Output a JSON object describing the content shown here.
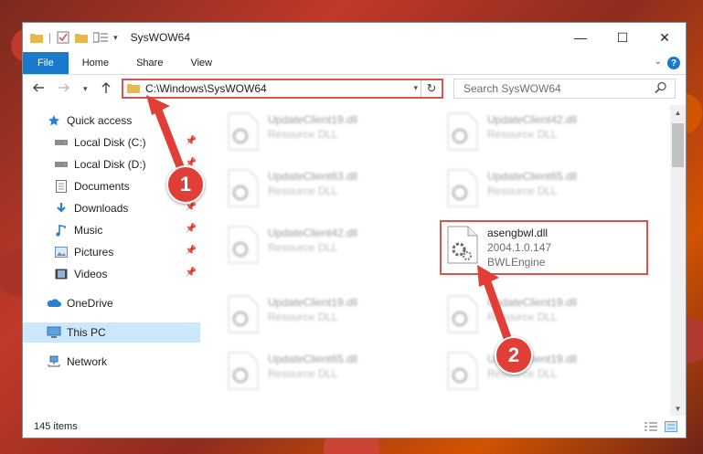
{
  "window": {
    "title": "SysWOW64",
    "controls": {
      "minimize": "—",
      "maximize": "☐",
      "close": "✕"
    }
  },
  "ribbon": {
    "tabs": [
      "File",
      "Home",
      "Share",
      "View"
    ],
    "help": "?"
  },
  "nav": {
    "address": "C:\\Windows\\SysWOW64",
    "search_placeholder": "Search SysWOW64"
  },
  "sidebar": {
    "items": [
      {
        "label": "Quick access",
        "icon": "star-icon"
      },
      {
        "label": "Local Disk (C:)",
        "icon": "drive-icon",
        "pinned": true
      },
      {
        "label": "Local Disk (D:)",
        "icon": "drive-icon",
        "pinned": true
      },
      {
        "label": "Documents",
        "icon": "documents-icon",
        "pinned": true
      },
      {
        "label": "Downloads",
        "icon": "downloads-icon",
        "pinned": true
      },
      {
        "label": "Music",
        "icon": "music-icon",
        "pinned": true
      },
      {
        "label": "Pictures",
        "icon": "pictures-icon",
        "pinned": true
      },
      {
        "label": "Videos",
        "icon": "videos-icon",
        "pinned": true
      },
      {
        "label": "OneDrive",
        "icon": "cloud-icon"
      },
      {
        "label": "This PC",
        "icon": "computer-icon",
        "selected": true
      },
      {
        "label": "Network",
        "icon": "network-icon"
      }
    ]
  },
  "files": [
    {
      "name": "UpdateClient19.dll",
      "desc": "Resource DLL"
    },
    {
      "name": "UpdateClient42.dll",
      "desc": "Resource DLL"
    },
    {
      "name": "UpdateClient63.dll",
      "desc": "Resource DLL"
    },
    {
      "name": "UpdateClient65.dll",
      "desc": "Resource DLL"
    },
    {
      "name": "UpdateClient42.dll",
      "desc": "Resource DLL"
    },
    {
      "name": "asengbwl.dll",
      "version": "2004.1.0.147",
      "desc": "BWLEngine",
      "highlighted": true
    },
    {
      "name": "UpdateClient19.dll",
      "desc": "Resource DLL"
    },
    {
      "name": "UpdateClient19.dll",
      "desc": "Resource DLL"
    },
    {
      "name": "UpdateClient65.dll",
      "desc": "Resource DLL"
    },
    {
      "name": "UpdateClient19.dll",
      "desc": "Resource DLL"
    }
  ],
  "status": {
    "count": "145 items"
  },
  "annotations": {
    "marker1": "1",
    "marker2": "2",
    "color": "#e03e36"
  }
}
